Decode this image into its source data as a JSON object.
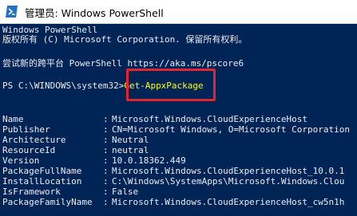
{
  "window": {
    "title": "管理员: Windows PowerShell",
    "icon": "powershell-icon",
    "colors": {
      "console_bg": "#012456",
      "console_text": "#eeedf0",
      "command_text": "#ffff00",
      "highlight_border": "#e0262e"
    }
  },
  "banner": {
    "line1": "Windows PowerShell",
    "line2": "版权所有 (C) Microsoft Corporation. 保留所有权利。",
    "line3": "尝试新的跨平台 PowerShell https://aka.ms/pscore6"
  },
  "prompt": {
    "path": "PS C:\\WINDOWS\\system32>",
    "command": "Get-AppxPackage"
  },
  "properties": [
    {
      "name": "Name",
      "value": "Microsoft.Windows.CloudExperienceHost"
    },
    {
      "name": "Publisher",
      "value": "CN=Microsoft Windows, O=Microsoft Corporation"
    },
    {
      "name": "Architecture",
      "value": "Neutral"
    },
    {
      "name": "ResourceId",
      "value": "neutral"
    },
    {
      "name": "Version",
      "value": "10.0.18362.449"
    },
    {
      "name": "PackageFullName",
      "value": "Microsoft.Windows.CloudExperienceHost_10.0.1"
    },
    {
      "name": "InstallLocation",
      "value": "C:\\Windows\\SystemApps\\Microsoft.Windows.Clou"
    },
    {
      "name": "IsFramework",
      "value": "False"
    },
    {
      "name": "PackageFamilyName",
      "value": "Microsoft.Windows.CloudExperienceHost_cw5n1h"
    }
  ]
}
